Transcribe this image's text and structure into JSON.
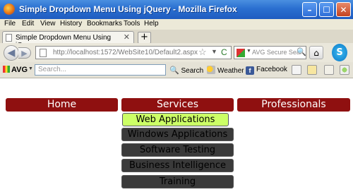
{
  "window": {
    "title": "Simple Dropdown Menu Using jQuery - Mozilla Firefox",
    "min": "–",
    "max": "☐",
    "close": "✕"
  },
  "menubar": [
    "File",
    "Edit",
    "View",
    "History",
    "Bookmarks",
    "Tools",
    "Help"
  ],
  "tab": {
    "title": "Simple Dropdown Menu Using jQuery",
    "close": "✕",
    "new": "+"
  },
  "address": {
    "url": "http://localhost:1572/WebSite10/Default2.aspx",
    "star": "☆",
    "dropdown": "▼",
    "reload": "C"
  },
  "search_box": {
    "placeholder": "AVG Secure Sear",
    "icon": "🔍"
  },
  "avg_toolbar": {
    "logo": "AVG",
    "dropdown": "▼",
    "search_placeholder": "Search...",
    "search_label": "Search",
    "weather_label": "Weather",
    "facebook_label": "Facebook"
  },
  "menu": {
    "items": [
      "Home",
      "Services",
      "Professionals"
    ],
    "services_submenu": [
      "Web Applications",
      "Windows Applications",
      "Software Testing",
      "Business Intelligence",
      "Training"
    ],
    "active_sub_index": 0
  },
  "colors": {
    "menu_bg": "#8f1010",
    "submenu_bg": "#3a3a3a",
    "submenu_active": "#ccff66"
  }
}
